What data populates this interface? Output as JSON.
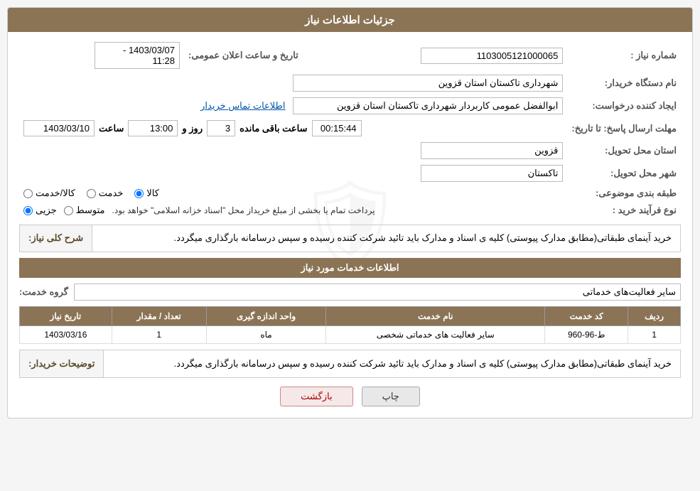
{
  "header": {
    "title": "جزئیات اطلاعات نیاز"
  },
  "fields": {
    "shomara_niaz_label": "شماره نیاز :",
    "shomara_niaz_value": "1103005121000065",
    "nam_dastgah_label": "نام دستگاه خریدار:",
    "nam_dastgah_value": "شهرداری تاکستان استان قزوین",
    "ijad_konande_label": "ایجاد کننده درخواست:",
    "ijad_konande_value": "ابوالفضل عمومی کاربردار شهرداری تاکستان استان قزوین",
    "ettelaat_link": "اطلاعات تماس خریدار",
    "mohlat_label": "مهلت ارسال پاسخ: تا تاریخ:",
    "tarikh_date": "1403/03/10",
    "saat_label": "ساعت",
    "saat_value": "13:00",
    "roz_label": "روز و",
    "roz_value": "3",
    "baqi_label": "ساعت باقی مانده",
    "baqi_value": "00:15:44",
    "tarikh_elaan_label": "تاریخ و ساعت اعلان عمومی:",
    "tarikh_elaan_value": "1403/03/07 - 11:28",
    "ostan_label": "استان محل تحویل:",
    "ostan_value": "قزوین",
    "shahr_label": "شهر محل تحویل:",
    "shahr_value": "تاکستان",
    "tabagheh_label": "طبقه بندی موضوعی:",
    "tabagheh_kala": "کالا",
    "tabagheh_khedmat": "خدمت",
    "tabagheh_kala_khedmat": "کالا/خدمت",
    "nooe_farayand_label": "نوع فرآیند خرید :",
    "nooe_jozi": "جزیی",
    "nooe_motaset": "متوسط",
    "nooe_note": "پرداخت تمام یا بخشی از مبلغ خریداز محل \"اسناد خزانه اسلامی\" خواهد بود.",
    "sharh_label": "شرح کلی نیاز:",
    "sharh_text": "خرید آینماى طبقاتى(مطابق مدارک پیوستى) کلیه ى اسناد و مدارک باید تائید شرکت کننده رسیده و سپس درسامانه بارگذاری میگردد.",
    "ettelaat_khadamat_header": "اطلاعات خدمات مورد نیاز",
    "gorooh_label": "گروه خدمت:",
    "gorooh_value": "سایر فعالیت‌های خدماتی",
    "table": {
      "headers": [
        "ردیف",
        "کد خدمت",
        "نام خدمت",
        "واحد اندازه گیری",
        "تعداد / مقدار",
        "تاریخ نیاز"
      ],
      "rows": [
        {
          "radif": "1",
          "kod_khedmat": "ط-96-960",
          "nam_khedmat": "سایر فعالیت های خدماتی شخصی",
          "vahed": "ماه",
          "tedad": "1",
          "tarikh_niaz": "1403/03/16"
        }
      ]
    },
    "tazih_label": "توضیحات خریدار:",
    "tazih_text": "خرید آینماى طبقاتى(مطابق مدارک پیوستى) کلیه ى اسناد و مدارک باید تائید شرکت کننده رسیده و سپس درسامانه بارگذاری میگردد."
  },
  "buttons": {
    "chap": "چاپ",
    "bazgasht": "بازگشت"
  }
}
